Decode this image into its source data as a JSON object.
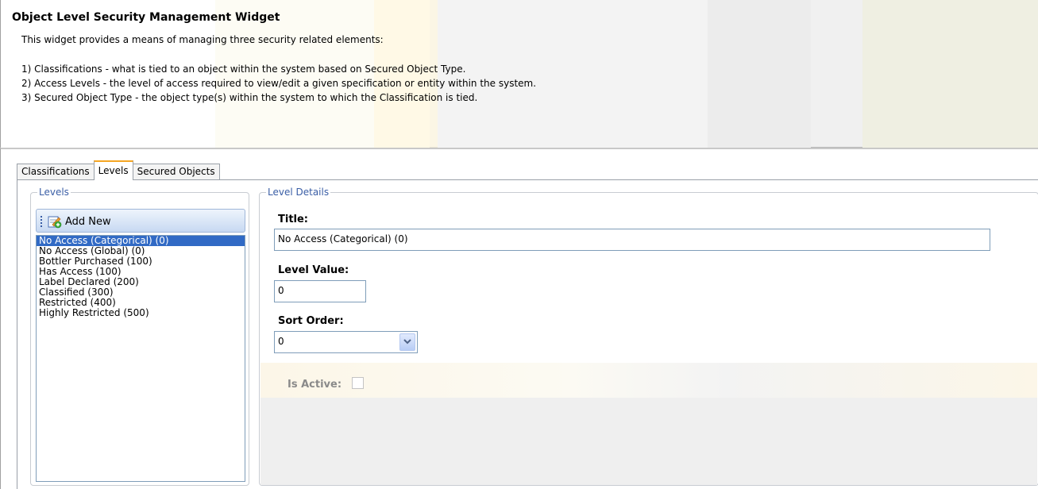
{
  "header": {
    "title": "Object Level Security Management Widget",
    "intro": "This widget provides a means of managing three security related elements:",
    "items": [
      "1) Classifications - what is tied to an object within the system based on Secured Object Type.",
      "2) Access Levels - the level of access required to view/edit a given specification or entity within the system.",
      "3) Secured Object Type - the object type(s) within the system to which the Classification is tied."
    ]
  },
  "tabs": [
    {
      "label": "Classifications",
      "active": false
    },
    {
      "label": "Levels",
      "active": true
    },
    {
      "label": "Secured Objects",
      "active": false
    }
  ],
  "levels_panel": {
    "legend": "Levels",
    "add_new_label": "Add New",
    "items": [
      "No Access (Categorical) (0)",
      "No Access (Global) (0)",
      "Bottler Purchased (100)",
      "Has Access (100)",
      "Label Declared (200)",
      "Classified (300)",
      "Restricted (400)",
      "Highly Restricted (500)"
    ],
    "selected_index": 0
  },
  "details_panel": {
    "legend": "Level Details",
    "title_label": "Title:",
    "title_value": "No Access (Categorical) (0)",
    "level_value_label": "Level Value:",
    "level_value": "0",
    "sort_order_label": "Sort Order:",
    "sort_order_value": "0",
    "is_active_label": "Is Active:",
    "is_active_checked": false
  },
  "colors": {
    "selection": "#316ac5",
    "legend_text": "#3a5ea6",
    "active_tab_accent": "#f5a623"
  }
}
